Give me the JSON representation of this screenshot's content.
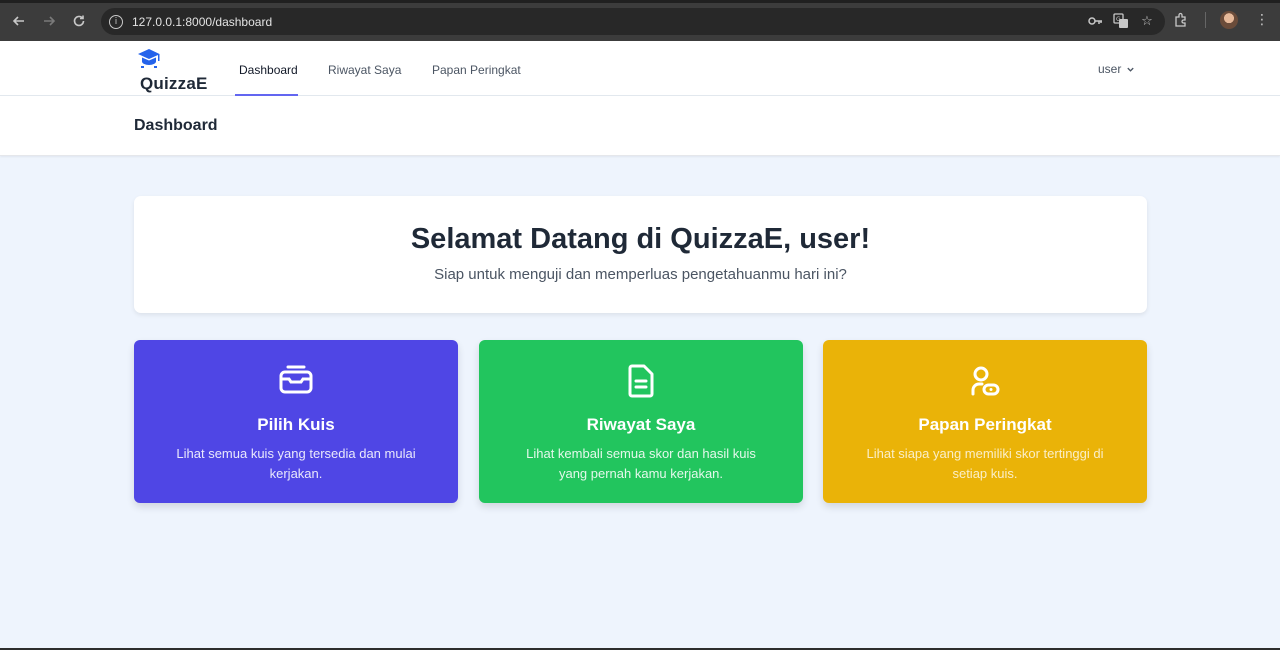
{
  "browser": {
    "url": "127.0.0.1:8000/dashboard",
    "icons": [
      "back-icon",
      "forward-icon",
      "reload-icon",
      "info-icon",
      "key-icon",
      "translate-icon",
      "star-icon",
      "extensions-icon",
      "profile-avatar",
      "menu-icon"
    ]
  },
  "nav": {
    "brand": "QuizzaE",
    "links": [
      "Dashboard",
      "Riwayat Saya",
      "Papan Peringkat"
    ],
    "active": "Dashboard",
    "user": "user"
  },
  "header": {
    "title": "Dashboard"
  },
  "welcome": {
    "title": "Selamat Datang di QuizzaE, user!",
    "subtitle": "Siap untuk menguji dan memperluas pengetahuanmu hari ini?"
  },
  "cards": [
    {
      "title": "Pilih Kuis",
      "description": "Lihat semua kuis yang tersedia dan mulai kerjakan.",
      "color": "#4f46e5",
      "icon": "inbox-icon"
    },
    {
      "title": "Riwayat Saya",
      "description": "Lihat kembali semua skor dan hasil kuis yang pernah kamu kerjakan.",
      "color": "#22c55e",
      "icon": "document-icon"
    },
    {
      "title": "Papan Peringkat",
      "description": "Lihat siapa yang memiliki skor tertinggi di setiap kuis.",
      "color": "#eab308",
      "icon": "user-badge-icon"
    }
  ],
  "colors": {
    "accent": "#6366f1",
    "page_bg": "#eef4fd"
  }
}
